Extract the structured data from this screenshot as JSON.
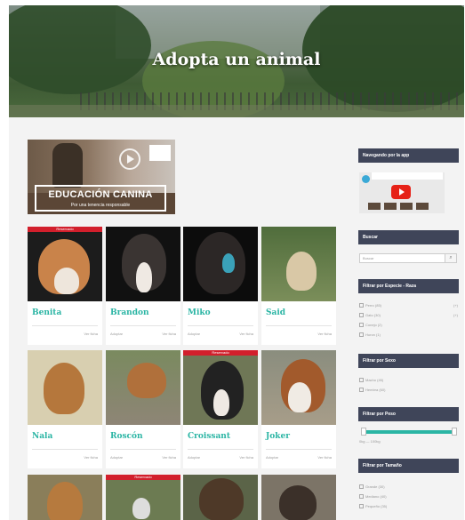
{
  "hero": {
    "title": "Adopta un animal"
  },
  "banner": {
    "title": "EDUCACIÓN CANINA",
    "subtitle": "Por una tenencia responsable"
  },
  "cards": [
    {
      "name": "Benita",
      "ribbon": "Reservado",
      "tag": "",
      "meta_left": "",
      "meta_right": "Ver ficha"
    },
    {
      "name": "Brandon",
      "ribbon": "",
      "tag": "",
      "meta_left": "Adoptar",
      "meta_right": "Ver ficha"
    },
    {
      "name": "Miko",
      "ribbon": "",
      "tag": "",
      "meta_left": "Adoptar",
      "meta_right": "Ver ficha"
    },
    {
      "name": "Said",
      "ribbon": "",
      "tag": "",
      "meta_left": "",
      "meta_right": "Ver ficha"
    },
    {
      "name": "Nala",
      "ribbon": "",
      "tag": "",
      "meta_left": "",
      "meta_right": "Ver ficha"
    },
    {
      "name": "Roscón",
      "ribbon": "",
      "tag": "",
      "meta_left": "Adoptar",
      "meta_right": "Ver ficha"
    },
    {
      "name": "Croissant",
      "ribbon": "Reservado",
      "tag": "",
      "meta_left": "Adoptar",
      "meta_right": "Ver ficha"
    },
    {
      "name": "Joker",
      "ribbon": "",
      "tag": "",
      "meta_left": "Adoptar",
      "meta_right": "Ver ficha"
    }
  ],
  "bottom_row_ribbon": "Reservado",
  "sidebar": {
    "app_title": "Navegando por la app",
    "search_title": "Buscar",
    "search_placeholder": "Buscar",
    "search_icon": "search-icon",
    "species_title": "Filtrar por Especie - Raza",
    "species_options": [
      {
        "label": "Perro (85)",
        "count": "(+)"
      },
      {
        "label": "Gato (30)",
        "count": "(+)"
      },
      {
        "label": "Conejo (2)",
        "count": ""
      },
      {
        "label": "Huron (1)",
        "count": ""
      }
    ],
    "sex_title": "Filtrar por Sexo",
    "sex_options": [
      {
        "label": "Macho (45)"
      },
      {
        "label": "Hembra (60)"
      }
    ],
    "weight_title": "Filtrar por Peso",
    "weight_range_text": "0kg — 100kg",
    "weight_min_fraction": 0.0,
    "weight_max_fraction": 1.0,
    "size_title": "Filtrar por Tamaño",
    "size_options": [
      {
        "label": "Grande (30)"
      },
      {
        "label": "Mediano (40)"
      },
      {
        "label": "Pequeño (35)"
      }
    ]
  },
  "colors": {
    "accent": "#2bb5a4",
    "widget_header": "#3f4559",
    "ribbon": "#d21f2c"
  }
}
